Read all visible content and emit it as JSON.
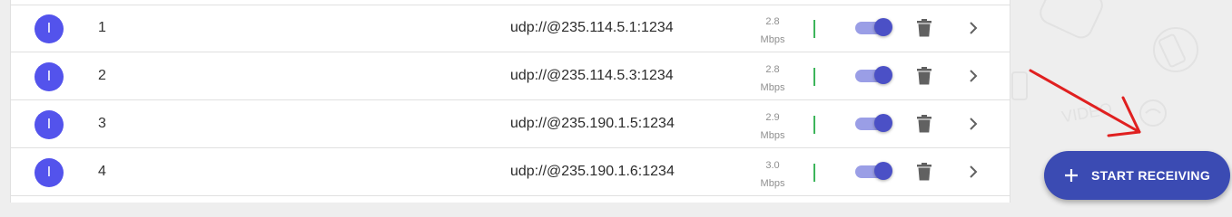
{
  "streams": [
    {
      "avatar": "I",
      "index": "1",
      "url": "udp://@235.114.5.1:1234",
      "rate_value": "2.8",
      "rate_unit": "Mbps",
      "enabled": true
    },
    {
      "avatar": "I",
      "index": "2",
      "url": "udp://@235.114.5.3:1234",
      "rate_value": "2.8",
      "rate_unit": "Mbps",
      "enabled": true
    },
    {
      "avatar": "I",
      "index": "3",
      "url": "udp://@235.190.1.5:1234",
      "rate_value": "2.9",
      "rate_unit": "Mbps",
      "enabled": true
    },
    {
      "avatar": "I",
      "index": "4",
      "url": "udp://@235.190.1.6:1234",
      "rate_value": "3.0",
      "rate_unit": "Mbps",
      "enabled": true
    }
  ],
  "fab": {
    "label": "START RECEIVING",
    "icon": "plus-icon"
  },
  "colors": {
    "avatar": "#5353ec",
    "signal": "#3cb55a",
    "toggle_track": "#9a9ee6",
    "toggle_knob": "#4b50c6",
    "fab": "#3b4bb3",
    "annotation_arrow": "#e02020"
  },
  "icons": {
    "delete": "trash-icon",
    "open": "chevron-right-icon"
  }
}
